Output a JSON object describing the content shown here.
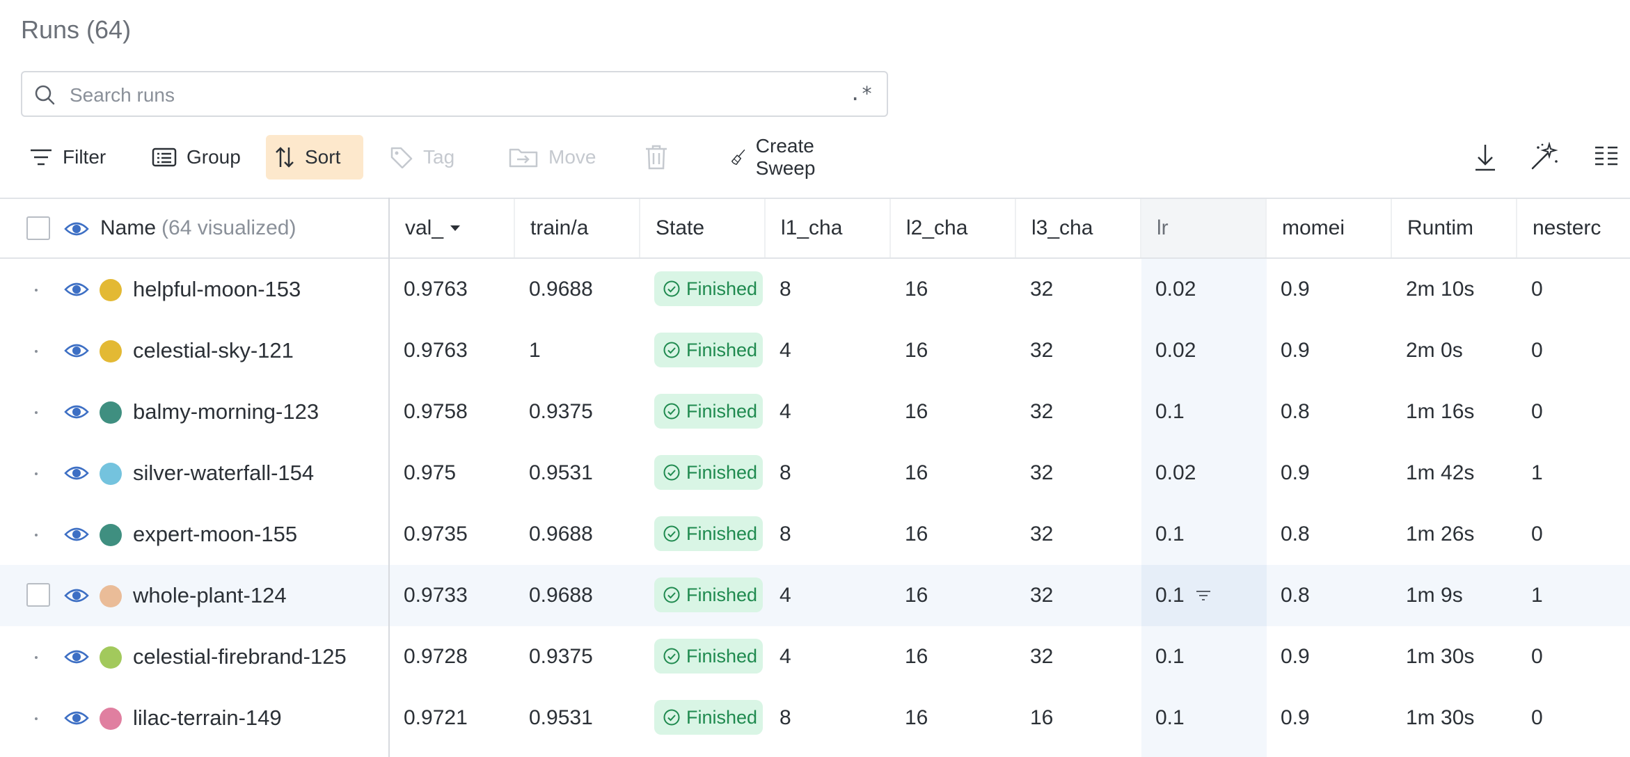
{
  "page": {
    "title": "Runs (64)"
  },
  "search": {
    "placeholder": "Search runs",
    "regex_label": ".*"
  },
  "toolbar": {
    "filter": "Filter",
    "group": "Group",
    "sort": "Sort",
    "tag": "Tag",
    "move": "Move",
    "create_sweep": "Create Sweep"
  },
  "icons": {
    "search": "search-icon",
    "filter": "filter-icon",
    "group": "group-icon",
    "sort": "sort-icon",
    "tag": "tag-icon",
    "move": "move-icon",
    "delete": "trash-icon",
    "sweep": "broom-icon",
    "download": "download-icon",
    "magic": "magic-wand-icon",
    "columns": "columns-icon"
  },
  "table": {
    "name_header": "Name",
    "visualized": "(64 visualized)",
    "columns": [
      "val_",
      "train/a",
      "State",
      "l1_cha",
      "l2_cha",
      "l3_cha",
      "lr",
      "momei",
      "Runtim",
      "nesterc"
    ],
    "rows": [
      {
        "name": "helpful-moon-153",
        "color": "#e3b934",
        "val": "0.9763",
        "train": "0.9688",
        "state": "Finished",
        "l1": "8",
        "l2": "16",
        "l3": "32",
        "lr": "0.02",
        "momentum": "0.9",
        "runtime": "2m 10s",
        "nesterov": "0"
      },
      {
        "name": "celestial-sky-121",
        "color": "#e3b934",
        "val": "0.9763",
        "train": "1",
        "state": "Finished",
        "l1": "4",
        "l2": "16",
        "l3": "32",
        "lr": "0.02",
        "momentum": "0.9",
        "runtime": "2m 0s",
        "nesterov": "0"
      },
      {
        "name": "balmy-morning-123",
        "color": "#3f8f80",
        "val": "0.9758",
        "train": "0.9375",
        "state": "Finished",
        "l1": "4",
        "l2": "16",
        "l3": "32",
        "lr": "0.1",
        "momentum": "0.8",
        "runtime": "1m 16s",
        "nesterov": "0"
      },
      {
        "name": "silver-waterfall-154",
        "color": "#74c3de",
        "val": "0.975",
        "train": "0.9531",
        "state": "Finished",
        "l1": "8",
        "l2": "16",
        "l3": "32",
        "lr": "0.02",
        "momentum": "0.9",
        "runtime": "1m 42s",
        "nesterov": "1"
      },
      {
        "name": "expert-moon-155",
        "color": "#3f8f80",
        "val": "0.9735",
        "train": "0.9688",
        "state": "Finished",
        "l1": "8",
        "l2": "16",
        "l3": "32",
        "lr": "0.1",
        "momentum": "0.8",
        "runtime": "1m 26s",
        "nesterov": "0"
      },
      {
        "name": "whole-plant-124",
        "color": "#eabc98",
        "val": "0.9733",
        "train": "0.9688",
        "state": "Finished",
        "l1": "4",
        "l2": "16",
        "l3": "32",
        "lr": "0.1",
        "momentum": "0.8",
        "runtime": "1m 9s",
        "nesterov": "1"
      },
      {
        "name": "celestial-firebrand-125",
        "color": "#a2c95c",
        "val": "0.9728",
        "train": "0.9375",
        "state": "Finished",
        "l1": "4",
        "l2": "16",
        "l3": "32",
        "lr": "0.1",
        "momentum": "0.9",
        "runtime": "1m 30s",
        "nesterov": "0"
      },
      {
        "name": "lilac-terrain-149",
        "color": "#e07fa0",
        "val": "0.9721",
        "train": "0.9531",
        "state": "Finished",
        "l1": "8",
        "l2": "16",
        "l3": "16",
        "lr": "0.1",
        "momentum": "0.9",
        "runtime": "1m 30s",
        "nesterov": "0"
      }
    ]
  },
  "colors": {
    "accent": "#3d6fc4",
    "sort_active_bg": "#fde8cc",
    "finished_bg": "#d9f5e5",
    "finished_fg": "#1f8a4f"
  }
}
